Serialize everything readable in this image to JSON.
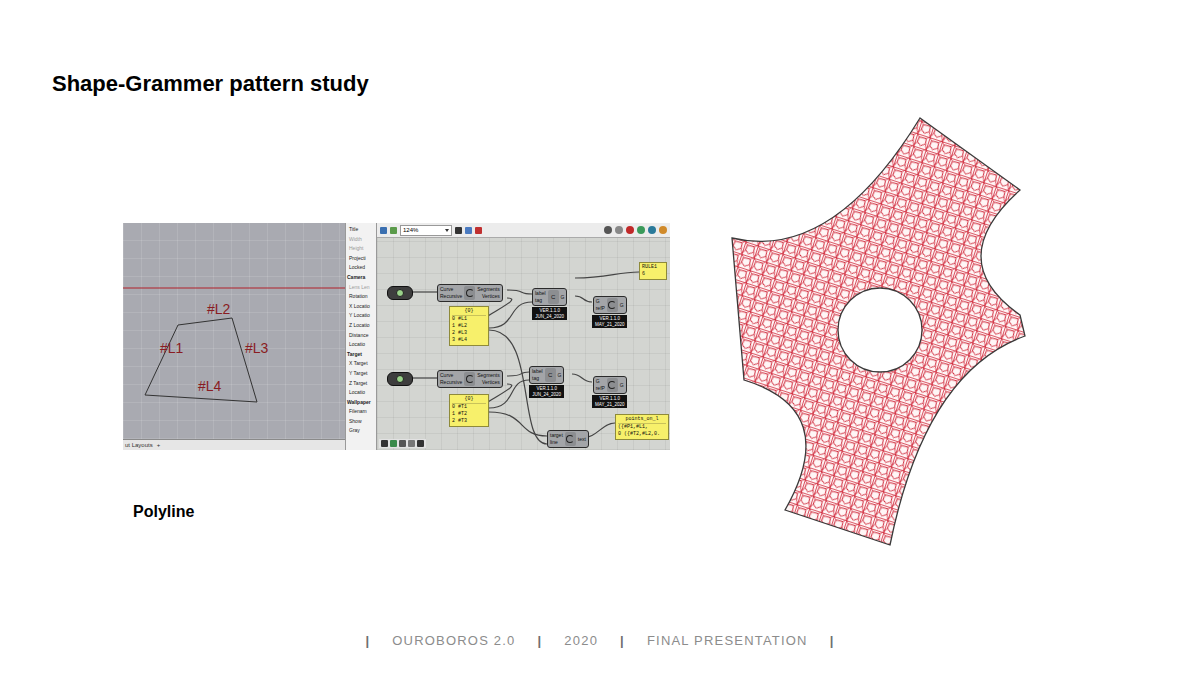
{
  "slide": {
    "title": "Shape-Grammer pattern study"
  },
  "screenshot": {
    "viewport": {
      "labels": [
        {
          "text": "#L2"
        },
        {
          "text": "#L1"
        },
        {
          "text": "#L3"
        },
        {
          "text": "#L4"
        }
      ],
      "tab": "ut Layouts",
      "add": "+"
    },
    "properties": [
      {
        "label": "Title",
        "kind": "field"
      },
      {
        "label": "Width",
        "kind": "disabled"
      },
      {
        "label": "Height",
        "kind": "disabled"
      },
      {
        "label": "Projecti",
        "kind": "field"
      },
      {
        "label": "Locked",
        "kind": "field"
      },
      {
        "label": "Camera",
        "kind": "header"
      },
      {
        "label": "Lens Len",
        "kind": "disabled"
      },
      {
        "label": "Rotation",
        "kind": "field"
      },
      {
        "label": "X Locatio",
        "kind": "field"
      },
      {
        "label": "Y Locatio",
        "kind": "field"
      },
      {
        "label": "Z Locatio",
        "kind": "field"
      },
      {
        "label": "Distance",
        "kind": "field"
      },
      {
        "label": "Locatio",
        "kind": "field"
      },
      {
        "label": "Target",
        "kind": "header"
      },
      {
        "label": "X Target",
        "kind": "field"
      },
      {
        "label": "Y Target",
        "kind": "field"
      },
      {
        "label": "Z Target",
        "kind": "field"
      },
      {
        "label": "Locatio",
        "kind": "field"
      },
      {
        "label": "Wallpaper",
        "kind": "header"
      },
      {
        "label": "Filenam",
        "kind": "field"
      },
      {
        "label": "Show",
        "kind": "field"
      },
      {
        "label": "Gray",
        "kind": "field"
      }
    ],
    "canvas": {
      "zoom": "124%",
      "nodes": [
        {
          "kind": "param"
        },
        {
          "kind": "component",
          "inputs": [
            "Curve",
            "Recursive"
          ],
          "outputs": [
            "Segments",
            "Vertices"
          ]
        },
        {
          "kind": "component",
          "header": "C",
          "inputs": [
            "label",
            "tag"
          ],
          "outputs": [
            "G"
          ],
          "badge": [
            "VER.1.1.0",
            "JUN_24_2020"
          ]
        },
        {
          "kind": "component",
          "inputs": [
            "G",
            "refP"
          ],
          "outputs": [
            "G"
          ],
          "badge": [
            "VER.1.1.0",
            "MAY_21_2020"
          ]
        },
        {
          "kind": "panel",
          "lines": [
            "{0}",
            "0 #L1",
            "1 #L2",
            "2 #L3",
            "3 #L4"
          ]
        },
        {
          "kind": "panel",
          "lines": [
            "RULE1",
            "6"
          ]
        },
        {
          "kind": "param"
        },
        {
          "kind": "component",
          "inputs": [
            "Curve",
            "Recursive"
          ],
          "outputs": [
            "Segments",
            "Vertices"
          ]
        },
        {
          "kind": "component",
          "header": "C",
          "inputs": [
            "label",
            "tag"
          ],
          "outputs": [
            "G"
          ],
          "badge": [
            "VER.1.1.0",
            "JUN_24_2020"
          ]
        },
        {
          "kind": "component",
          "inputs": [
            "G",
            "refP"
          ],
          "outputs": [
            "G"
          ],
          "badge": [
            "VER.1.1.0",
            "MAY_21_2020"
          ]
        },
        {
          "kind": "panel",
          "lines": [
            "{0}",
            "0 #T1",
            "1 #T2",
            "2 #T3"
          ]
        },
        {
          "kind": "component",
          "inputs": [
            "target",
            "line"
          ],
          "outputs": [
            "text"
          ]
        },
        {
          "kind": "panel",
          "lines": [
            "points_on_l",
            "({#P1,#L1,",
            "0 ({#T2,#L2,0."
          ]
        }
      ]
    }
  },
  "caption": "Polyline",
  "footer": {
    "separator": "|",
    "items": [
      "OUROBOROS 2.0",
      "2020",
      "FINAL PRESENTATION"
    ]
  }
}
